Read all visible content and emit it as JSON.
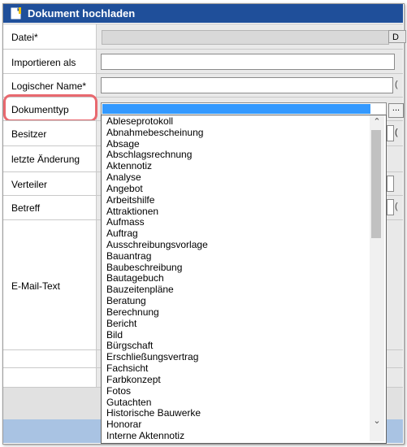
{
  "window": {
    "title": "Dokument hochladen"
  },
  "form": {
    "datei_label": "Datei*",
    "importieren_label": "Importieren als",
    "logischer_name_label": "Logischer Name*",
    "dokumenttyp_label": "Dokumenttyp",
    "besitzer_label": "Besitzer",
    "letzte_aenderung_label": "letzte Änderung",
    "verteiler_label": "Verteiler",
    "betreff_label": "Betreff",
    "email_text_label": "E-Mail-Text",
    "browse_button_text": "D",
    "picker_button_text": "...",
    "side_marks": [
      "(",
      "(",
      "(",
      "("
    ]
  },
  "dropdown": {
    "selected_value": "",
    "items": [
      "Ableseprotokoll",
      "Abnahmebescheinung",
      "Absage",
      "Abschlagsrechnung",
      "Aktennotiz",
      "Analyse",
      "Angebot",
      "Arbeitshilfe",
      "Attraktionen",
      "Aufmass",
      "Auftrag",
      "Ausschreibungsvorlage",
      "Bauantrag",
      "Baubeschreibung",
      "Bautagebuch",
      "Bauzeitenpläne",
      "Beratung",
      "Berechnung",
      "Bericht",
      "Bild",
      "Bürgschaft",
      "Erschließungsvertrag",
      "Fachsicht",
      "Farbkonzept",
      "Fotos",
      "Gutachten",
      "Historische Bauwerke",
      "Honorar",
      "Interne Aktennotiz"
    ]
  },
  "colors": {
    "titlebar": "#1f4f9a",
    "highlight": "#e8696f",
    "selection": "#3399ff",
    "footer": "#a9c3e3"
  }
}
